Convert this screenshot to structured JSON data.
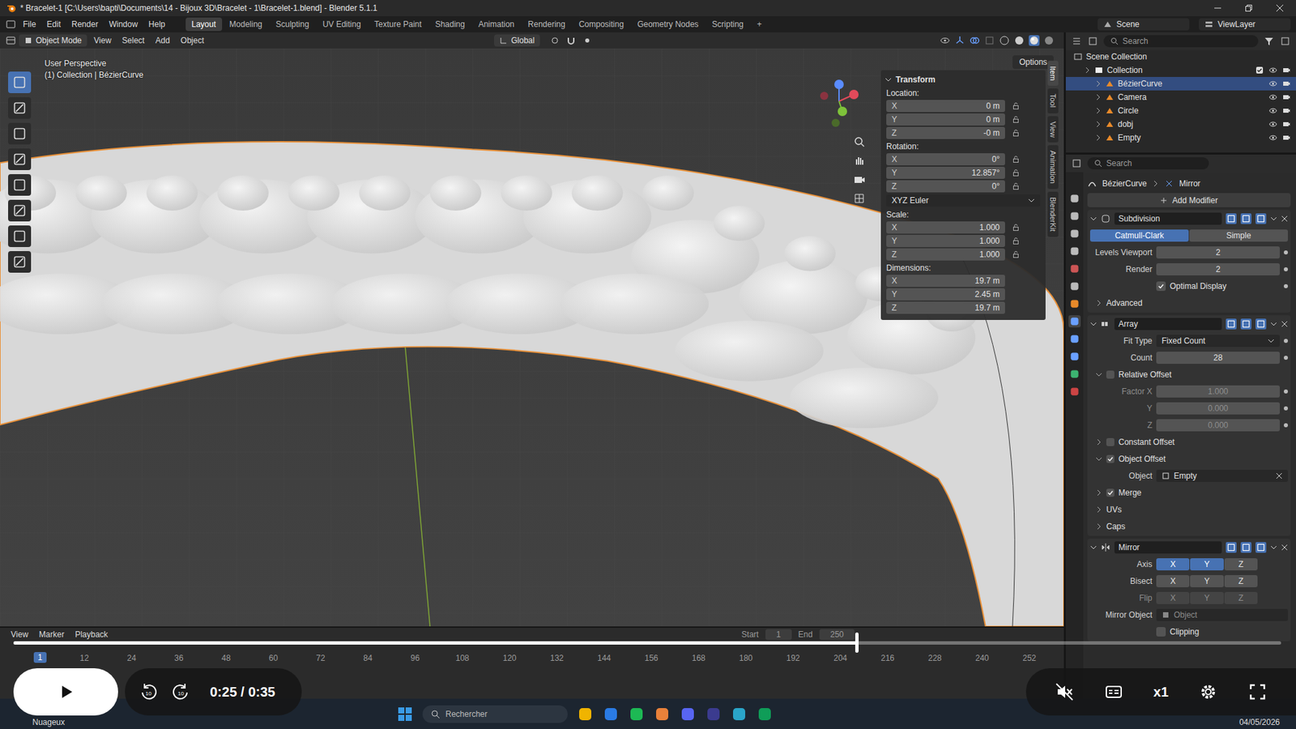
{
  "window": {
    "title": "* Bracelet-1 [C:\\Users\\bapti\\Documents\\14 - Bijoux 3D\\Bracelet - 1\\Bracelet-1.blend] - Blender 5.1.1"
  },
  "menus": [
    "File",
    "Edit",
    "Render",
    "Window",
    "Help"
  ],
  "workspaces": [
    {
      "label": "Layout",
      "selected": true
    },
    {
      "label": "Modeling",
      "selected": false
    },
    {
      "label": "Sculpting",
      "selected": false
    },
    {
      "label": "UV Editing",
      "selected": false
    },
    {
      "label": "Texture Paint",
      "selected": false
    },
    {
      "label": "Shading",
      "selected": false
    },
    {
      "label": "Animation",
      "selected": false
    },
    {
      "label": "Rendering",
      "selected": false
    },
    {
      "label": "Compositing",
      "selected": false
    },
    {
      "label": "Geometry Nodes",
      "selected": false
    },
    {
      "label": "Scripting",
      "selected": false
    }
  ],
  "add_workspace": "+",
  "scene": "Scene",
  "view_layer": "ViewLayer",
  "viewport_header": {
    "mode": "Object Mode",
    "menus": [
      "View",
      "Select",
      "Add",
      "Object"
    ],
    "orientation": "Global",
    "options": "Options"
  },
  "viewport": {
    "perspective": "User Perspective",
    "context": "(1) Collection | BézierCurve"
  },
  "sidebar_tabs": [
    {
      "label": "Item",
      "selected": true
    },
    {
      "label": "Tool",
      "selected": false
    },
    {
      "label": "View",
      "selected": false
    },
    {
      "label": "Animation",
      "selected": false
    },
    {
      "label": "BlenderKit",
      "selected": false
    }
  ],
  "transform": {
    "title": "Transform",
    "groups": [
      {
        "label": "Location:",
        "lockable": true,
        "fields": [
          {
            "axis": "X",
            "value": "0 m"
          },
          {
            "axis": "Y",
            "value": "0 m"
          },
          {
            "axis": "Z",
            "value": "-0 m"
          }
        ]
      },
      {
        "label": "Rotation:",
        "lockable": true,
        "dropdown": "XYZ Euler",
        "fields": [
          {
            "axis": "X",
            "value": "0°"
          },
          {
            "axis": "Y",
            "value": "12.857°"
          },
          {
            "axis": "Z",
            "value": "0°"
          }
        ]
      },
      {
        "label": "Scale:",
        "lockable": true,
        "fields": [
          {
            "axis": "X",
            "value": "1.000"
          },
          {
            "axis": "Y",
            "value": "1.000"
          },
          {
            "axis": "Z",
            "value": "1.000"
          }
        ]
      },
      {
        "label": "Dimensions:",
        "lockable": false,
        "fields": [
          {
            "axis": "X",
            "value": "19.7 m"
          },
          {
            "axis": "Y",
            "value": "2.45 m"
          },
          {
            "axis": "Z",
            "value": "19.7 m"
          }
        ]
      }
    ]
  },
  "outliner": {
    "search": "Search",
    "items": [
      {
        "name": "Scene Collection",
        "depth": 0,
        "kind": "scene",
        "selected": false
      },
      {
        "name": "Collection",
        "depth": 1,
        "kind": "collection",
        "selected": false
      },
      {
        "name": "BézierCurve",
        "depth": 2,
        "kind": "object",
        "selected": true
      },
      {
        "name": "Camera",
        "depth": 2,
        "kind": "object",
        "selected": false
      },
      {
        "name": "Circle",
        "depth": 2,
        "kind": "object",
        "selected": false
      },
      {
        "name": "dobj",
        "depth": 2,
        "kind": "object",
        "selected": false
      },
      {
        "name": "Empty",
        "depth": 2,
        "kind": "object",
        "selected": false
      }
    ]
  },
  "properties": {
    "search": "Search",
    "breadcrumb": [
      "BézierCurve",
      "Mirror"
    ],
    "add_modifier": "Add Modifier",
    "subdivision": {
      "name": "Subdivision",
      "modes": [
        {
          "label": "Catmull-Clark",
          "selected": true
        },
        {
          "label": "Simple",
          "selected": false
        }
      ],
      "fields": [
        {
          "label": "Levels Viewport",
          "value": "2"
        },
        {
          "label": "Render",
          "value": "2"
        }
      ],
      "optimal_display": {
        "label": "Optimal Display",
        "checked": true
      },
      "advanced": "Advanced"
    },
    "array": {
      "name": "Array",
      "fit_type": {
        "label": "Fit Type",
        "value": "Fixed Count"
      },
      "count": {
        "label": "Count",
        "value": "28"
      },
      "relative_offset": {
        "label": "Relative Offset",
        "checked": false,
        "factors": [
          {
            "label": "Factor X",
            "value": "1.000"
          },
          {
            "label": "Y",
            "value": "0.000"
          },
          {
            "label": "Z",
            "value": "0.000"
          }
        ]
      },
      "constant_offset": {
        "label": "Constant Offset",
        "checked": false
      },
      "object_offset": {
        "label": "Object Offset",
        "checked": true,
        "object_label": "Object",
        "object": "Empty"
      },
      "merge": {
        "label": "Merge",
        "checked": true
      },
      "subpanels": [
        "UVs",
        "Caps"
      ]
    },
    "mirror": {
      "name": "Mirror",
      "rows": [
        {
          "label": "Axis",
          "disabled": false,
          "options": [
            {
              "label": "X",
              "selected": true
            },
            {
              "label": "Y",
              "selected": true
            },
            {
              "label": "Z",
              "selected": false
            }
          ]
        },
        {
          "label": "Bisect",
          "disabled": false,
          "options": [
            {
              "label": "X",
              "selected": false
            },
            {
              "label": "Y",
              "selected": false
            },
            {
              "label": "Z",
              "selected": false
            }
          ]
        },
        {
          "label": "Flip",
          "disabled": true,
          "options": [
            {
              "label": "X",
              "selected": false
            },
            {
              "label": "Y",
              "selected": false
            },
            {
              "label": "Z",
              "selected": false
            }
          ]
        }
      ],
      "mirror_object_label": "Mirror Object",
      "mirror_object_placeholder": "Object",
      "clipping": {
        "label": "Clipping",
        "checked": false
      }
    }
  },
  "timeline": {
    "menus": [
      "View",
      "Marker",
      "Playback"
    ],
    "current_frame": "1",
    "ticks": [
      "12",
      "24",
      "36",
      "48",
      "60",
      "72",
      "84",
      "96",
      "108",
      "120",
      "132",
      "144",
      "156",
      "168",
      "180",
      "192",
      "204",
      "216",
      "228",
      "240",
      "252"
    ],
    "start_label": "Start",
    "start": "1",
    "end_label": "End",
    "end": "250"
  },
  "video": {
    "time": "0:25 / 0:35",
    "level": 0.665,
    "skip_seconds": "10",
    "speed": "x1",
    "muted": true
  },
  "taskbar": {
    "weather": "Nuageux",
    "search": "Rechercher",
    "date": "04/05/2026"
  }
}
